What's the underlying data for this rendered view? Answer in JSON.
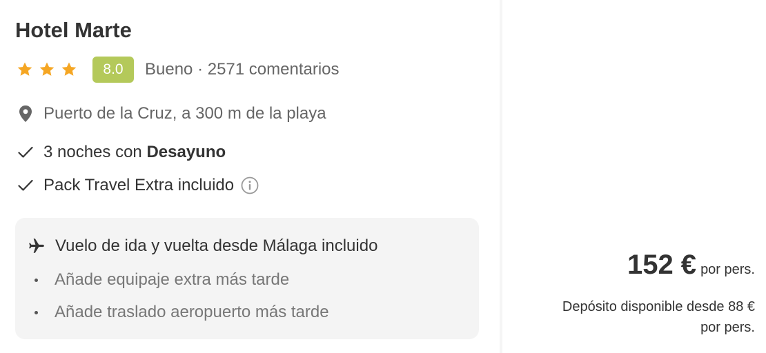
{
  "hotel": {
    "name": "Hotel Marte",
    "stars": 3,
    "star_icon": "star-icon",
    "score": "8.0",
    "score_color": "#b4c95a",
    "rating_text": "Bueno · 2571 comentarios",
    "location_icon": "map-pin-icon",
    "location": "Puerto de la Cruz, a 300 m de la playa"
  },
  "features": {
    "nights_prefix": "3 noches con ",
    "nights_board": "Desayuno",
    "pack": "Pack Travel Extra incluido"
  },
  "flight": {
    "icon": "plane-icon",
    "title": "Vuelo de ida y vuelta desde Málaga incluido",
    "extras": [
      "Añade equipaje extra más tarde",
      "Añade traslado aeropuerto más tarde"
    ]
  },
  "price": {
    "amount": "152 €",
    "per_person": "por pers.",
    "deposit_line1": "Depósito disponible desde 88 €",
    "deposit_line2": "por pers."
  },
  "colors": {
    "star": "#f5a623",
    "text_secondary": "#666666",
    "box_background": "#f4f4f4"
  }
}
